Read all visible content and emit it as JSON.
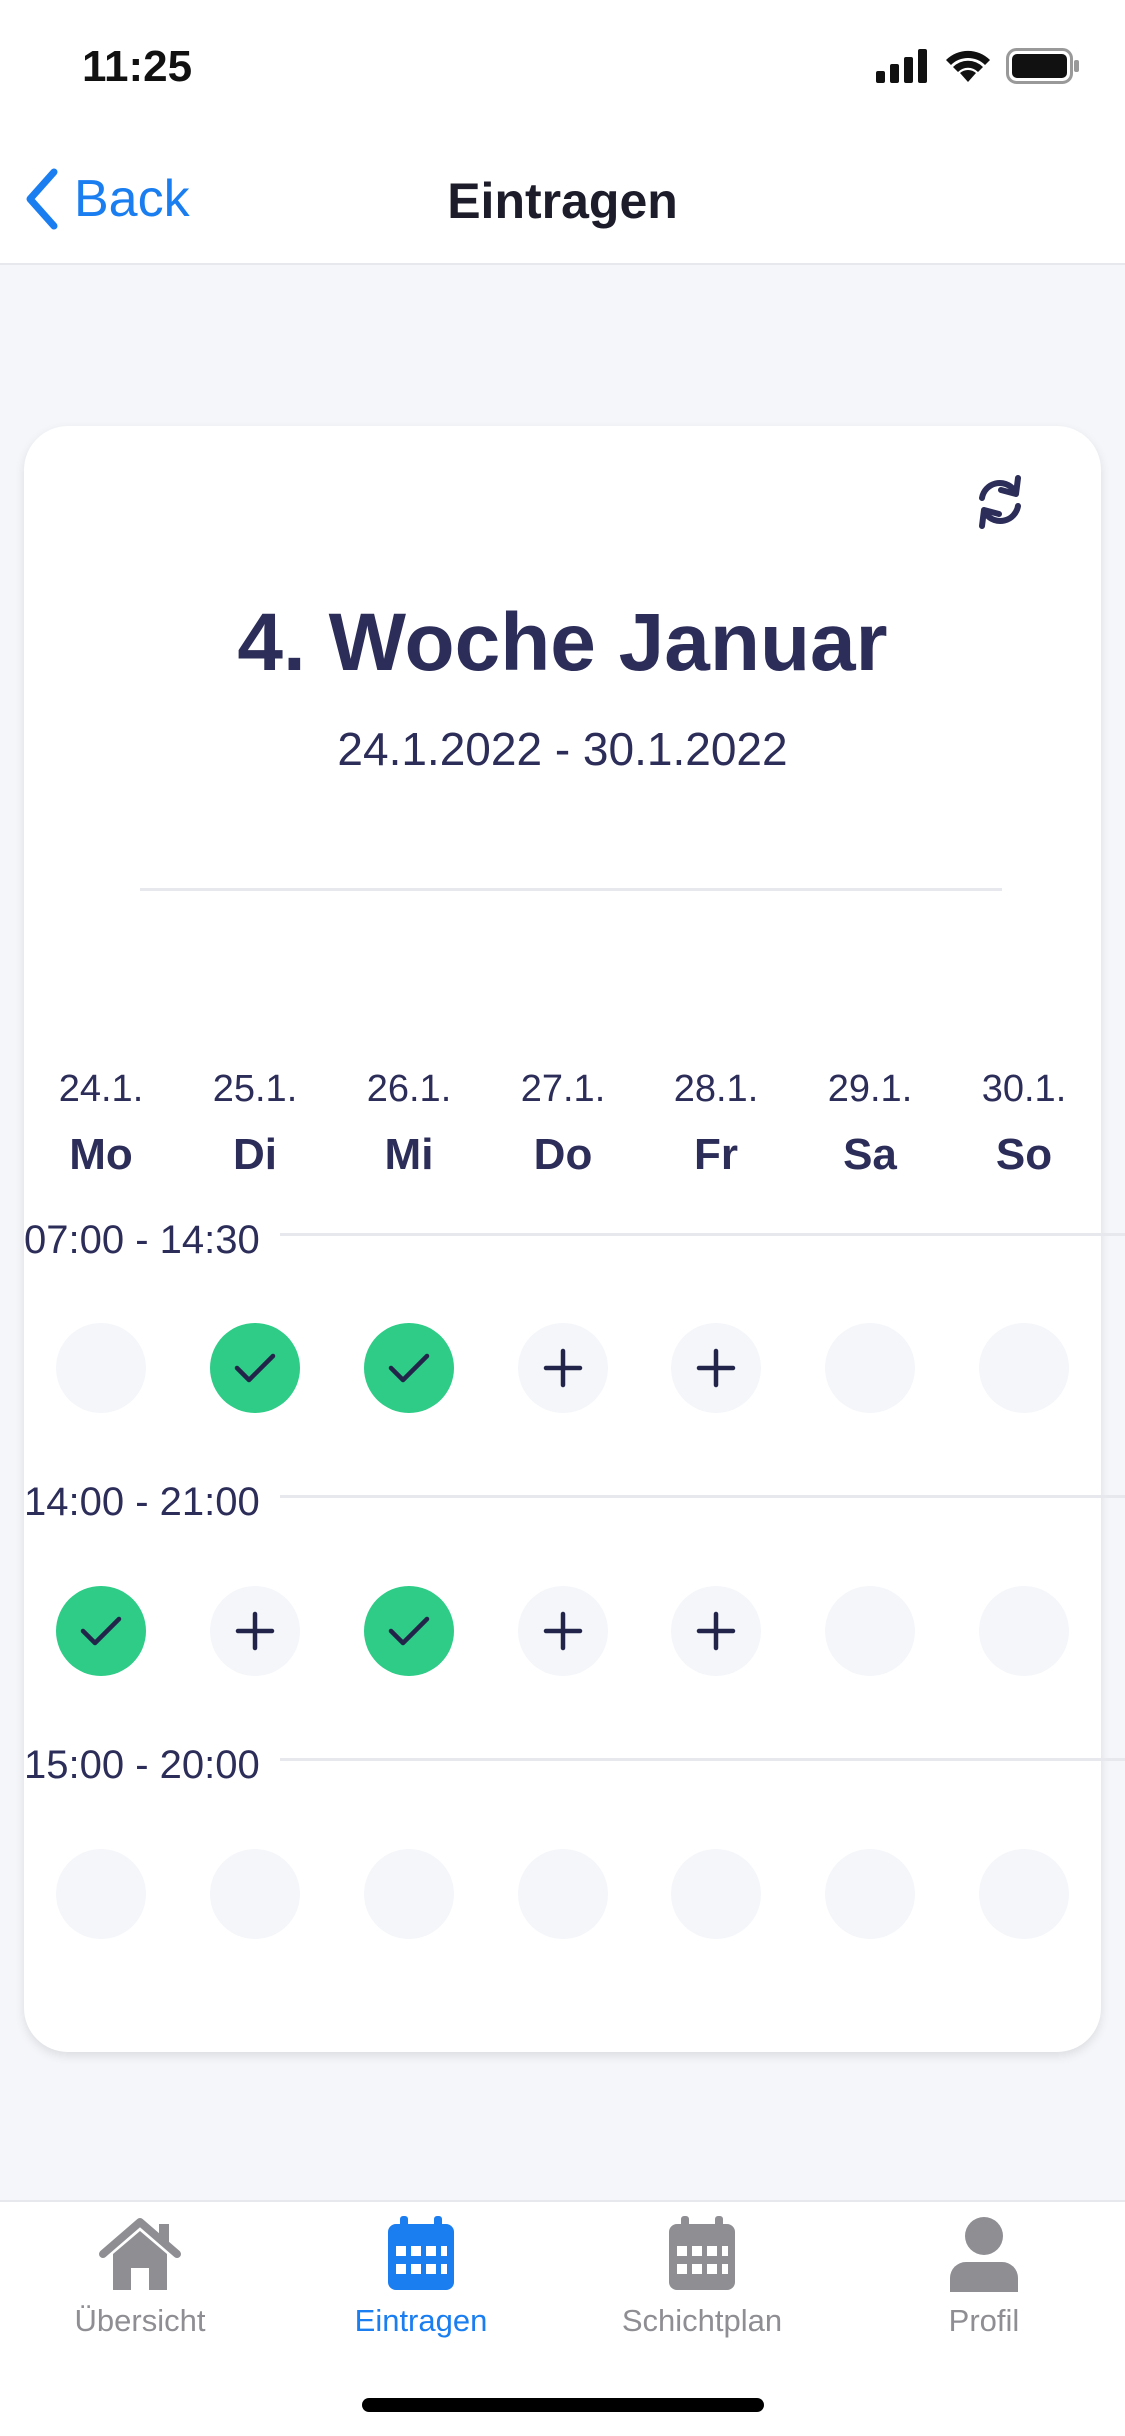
{
  "status": {
    "time": "11:25"
  },
  "nav": {
    "back_label": "Back",
    "title": "Eintragen"
  },
  "week": {
    "title": "4. Woche Januar",
    "range": "24.1.2022 - 30.1.2022"
  },
  "days": [
    {
      "date": "24.1.",
      "weekday": "Mo"
    },
    {
      "date": "25.1.",
      "weekday": "Di"
    },
    {
      "date": "26.1.",
      "weekday": "Mi"
    },
    {
      "date": "27.1.",
      "weekday": "Do"
    },
    {
      "date": "28.1.",
      "weekday": "Fr"
    },
    {
      "date": "29.1.",
      "weekday": "Sa"
    },
    {
      "date": "30.1.",
      "weekday": "So"
    }
  ],
  "shifts": [
    {
      "label": "07:00 - 14:30",
      "slots": [
        "empty",
        "checked",
        "checked",
        "add",
        "add",
        "empty",
        "empty"
      ]
    },
    {
      "label": "14:00 - 21:00",
      "slots": [
        "checked",
        "add",
        "checked",
        "add",
        "add",
        "empty",
        "empty"
      ]
    },
    {
      "label": "15:00 - 20:00",
      "slots": [
        "empty",
        "empty",
        "empty",
        "empty",
        "empty",
        "empty",
        "empty"
      ]
    }
  ],
  "tabs": [
    {
      "label": "Übersicht",
      "icon": "home-icon",
      "active": false
    },
    {
      "label": "Eintragen",
      "icon": "calendar-icon",
      "active": true
    },
    {
      "label": "Schichtplan",
      "icon": "calendar-icon",
      "active": false
    },
    {
      "label": "Profil",
      "icon": "person-icon",
      "active": false
    }
  ],
  "colors": {
    "accent": "#1a7df0",
    "checked": "#2ecc87",
    "text": "#2c2d58",
    "slot_empty": "#f4f6fa"
  }
}
